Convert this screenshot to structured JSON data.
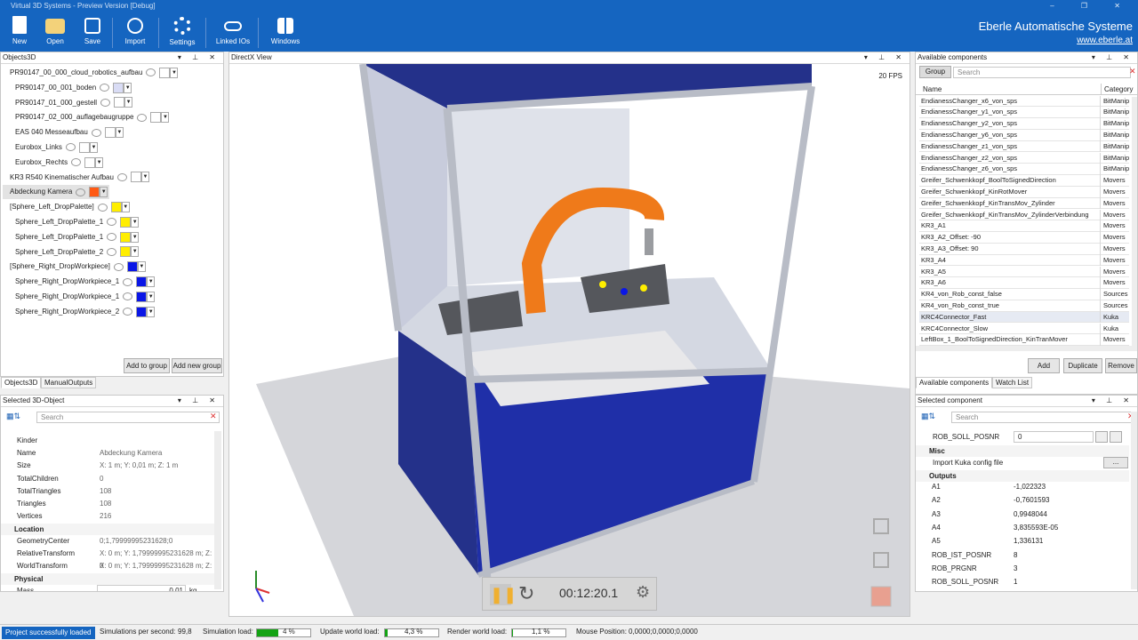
{
  "window": {
    "title": "Virtual 3D Systems - Preview Version [Debug]"
  },
  "toolbar": {
    "buttons": [
      {
        "label": "New",
        "icon": "new-file-icon"
      },
      {
        "label": "Open",
        "icon": "folder-open-icon"
      },
      {
        "label": "Save",
        "icon": "floppy-disk-icon"
      },
      {
        "label": "Import",
        "icon": "import-icon"
      },
      {
        "label": "Settings",
        "icon": "gear-icon"
      },
      {
        "label": "Linked IOs",
        "icon": "link-icon"
      },
      {
        "label": "Windows",
        "icon": "windows-icon"
      }
    ],
    "brand_name": "Eberle Automatische Systeme",
    "brand_url": "www.eberle.at"
  },
  "objects_panel": {
    "title": "Objects3D",
    "items": [
      {
        "label": "PR90147_00_000_cloud_robotics_aufbau",
        "color": "#ffffff"
      },
      {
        "label": "PR90147_00_001_boden",
        "color": "#d9dcf5"
      },
      {
        "label": "PR90147_01_000_gestell",
        "color": "#ffffff"
      },
      {
        "label": "PR90147_02_000_auflagebaugruppe",
        "color": "#ffffff"
      },
      {
        "label": "EAS 040 Messeaufbau",
        "color": "#ffffff"
      },
      {
        "label": "Eurobox_Links",
        "color": "#ffffff"
      },
      {
        "label": "Eurobox_Rechts",
        "color": "#ffffff"
      },
      {
        "label": "KR3 R540 Kinematischer Aufbau",
        "color": "#ffffff"
      },
      {
        "label": "Abdeckung Kamera",
        "color": "#ff5a14"
      },
      {
        "label": "[Sphere_Left_DropPalette]",
        "color": "#ffee00"
      },
      {
        "label": "Sphere_Left_DropPalette_1",
        "color": "#ffee00"
      },
      {
        "label": "Sphere_Left_DropPalette_1",
        "color": "#ffee00"
      },
      {
        "label": "Sphere_Left_DropPalette_2",
        "color": "#ffee00"
      },
      {
        "label": "[Sphere_Right_DropWorkpiece]",
        "color": "#0a16e6"
      },
      {
        "label": "Sphere_Right_DropWorkpiece_1",
        "color": "#0a16e6"
      },
      {
        "label": "Sphere_Right_DropWorkpiece_1",
        "color": "#0a16e6"
      },
      {
        "label": "Sphere_Right_DropWorkpiece_2",
        "color": "#0a16e6"
      }
    ],
    "add_to_group": "Add to group",
    "add_new_group": "Add new group",
    "tabs": [
      "Objects3D",
      "ManualOutputs"
    ]
  },
  "selected_object": {
    "title": "Selected 3D-Object",
    "search_placeholder": "Search",
    "props": [
      {
        "k": "Kinder",
        "v": ""
      },
      {
        "k": "Name",
        "v": "Abdeckung Kamera"
      },
      {
        "k": "Size",
        "v": "X: 1 m; Y: 0,01 m; Z: 1 m"
      },
      {
        "k": "TotalChildren",
        "v": "0"
      },
      {
        "k": "TotalTriangles",
        "v": "108"
      },
      {
        "k": "Triangles",
        "v": "108"
      },
      {
        "k": "Vertices",
        "v": "216"
      }
    ],
    "location_label": "Location",
    "location": [
      {
        "k": "GeometryCenter",
        "v": "0;1,79999995231628;0"
      },
      {
        "k": "RelativeTransform",
        "v": "X: 0 m; Y: 1,79999995231628 m; Z: 0"
      },
      {
        "k": "WorldTransform",
        "v": "X: 0 m; Y: 1,79999995231628 m; Z: 0"
      }
    ],
    "physical_label": "Physical",
    "mass_label": "Mass",
    "mass_value": "0,01",
    "mass_unit": "kg"
  },
  "viewport": {
    "title": "DirectX View",
    "fps": "20 FPS",
    "time": "00:12:20.1"
  },
  "components": {
    "title": "Available components",
    "group_button": "Group",
    "search_placeholder": "Search",
    "col_name": "Name",
    "col_category": "Category",
    "rows": [
      {
        "name": "EndianessChanger_x6_von_sps",
        "cat": "BitManip"
      },
      {
        "name": "EndianessChanger_y1_von_sps",
        "cat": "BitManip"
      },
      {
        "name": "EndianessChanger_y2_von_sps",
        "cat": "BitManip"
      },
      {
        "name": "EndianessChanger_y6_von_sps",
        "cat": "BitManip"
      },
      {
        "name": "EndianessChanger_z1_von_sps",
        "cat": "BitManip"
      },
      {
        "name": "EndianessChanger_z2_von_sps",
        "cat": "BitManip"
      },
      {
        "name": "EndianessChanger_z6_von_sps",
        "cat": "BitManip"
      },
      {
        "name": "Greifer_Schwenkkopf_BoolToSignedDirection",
        "cat": "Movers"
      },
      {
        "name": "Greifer_Schwenkkopf_KinRotMover",
        "cat": "Movers"
      },
      {
        "name": "Greifer_Schwenkkopf_KinTransMov_Zylinder",
        "cat": "Movers"
      },
      {
        "name": "Greifer_Schwenkkopf_KinTransMov_ZylinderVerbindung",
        "cat": "Movers"
      },
      {
        "name": "KR3_A1",
        "cat": "Movers"
      },
      {
        "name": "KR3_A2_Offset: -90",
        "cat": "Movers"
      },
      {
        "name": "KR3_A3_Offset: 90",
        "cat": "Movers"
      },
      {
        "name": "KR3_A4",
        "cat": "Movers"
      },
      {
        "name": "KR3_A5",
        "cat": "Movers"
      },
      {
        "name": "KR3_A6",
        "cat": "Movers"
      },
      {
        "name": "KR4_von_Rob_const_false",
        "cat": "Sources"
      },
      {
        "name": "KR4_von_Rob_const_true",
        "cat": "Sources"
      },
      {
        "name": "KRC4Connector_Fast",
        "cat": "Kuka"
      },
      {
        "name": "KRC4Connector_Slow",
        "cat": "Kuka"
      },
      {
        "name": "LeftBox_1_BoolToSignedDirection_KinTranMover",
        "cat": "Movers"
      }
    ],
    "add": "Add",
    "duplicate": "Duplicate",
    "remove": "Remove",
    "tabs": [
      "Available components",
      "Watch List"
    ]
  },
  "selected_component": {
    "title": "Selected component",
    "search_placeholder": "Search",
    "top_key": "ROB_SOLL_POSNR",
    "top_value": "0",
    "misc_label": "Misc",
    "import_label": "Import Kuka config file",
    "import_btn": "...",
    "outputs_label": "Outputs",
    "outputs": [
      {
        "k": "A1",
        "v": "-1,022323"
      },
      {
        "k": "A2",
        "v": "-0,7601593"
      },
      {
        "k": "A3",
        "v": "0,9948044"
      },
      {
        "k": "A4",
        "v": "3,835593E-05"
      },
      {
        "k": "A5",
        "v": "1,336131"
      },
      {
        "k": "ROB_IST_POSNR",
        "v": "8"
      },
      {
        "k": "ROB_PRGNR",
        "v": "3"
      },
      {
        "k": "ROB_SOLL_POSNR",
        "v": "1"
      }
    ]
  },
  "status": {
    "message": "Project successfully loaded",
    "sims_label": "Simulations per second:",
    "sims_value": "99,8",
    "sim_load_label": "Simulation load:",
    "sim_load_value": "4 %",
    "sim_load_fraction": 0.4,
    "world_label": "Update world load:",
    "world_value": "4,3 %",
    "world_fraction": 0.043,
    "render_label": "Render world load:",
    "render_value": "1,1 %",
    "render_fraction": 0.011,
    "mouse_label": "Mouse Position:",
    "mouse_value": "0,0000;0,0000;0,0000"
  }
}
